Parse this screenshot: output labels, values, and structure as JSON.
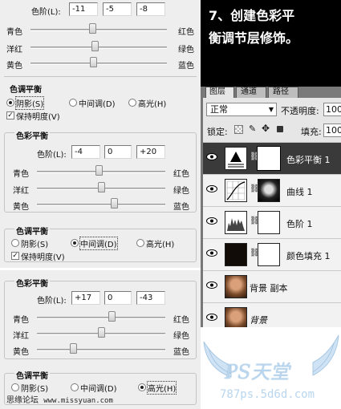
{
  "panel1": {
    "levels_label": "色阶(L):",
    "levels": [
      "-11",
      "-5",
      "-8"
    ],
    "rows": [
      {
        "left": "青色",
        "right": "红色",
        "pos": 0.45
      },
      {
        "left": "洋红",
        "right": "绿色",
        "pos": 0.47
      },
      {
        "left": "黄色",
        "right": "蓝色",
        "pos": 0.46
      }
    ]
  },
  "tone1": {
    "title": "色调平衡",
    "shadows": "阴影(S)",
    "midtones": "中间调(D)",
    "highlights": "高光(H)",
    "preserve": "保持明度(V)",
    "selected": "shadows",
    "preserve_checked": true
  },
  "panel2": {
    "title": "色彩平衡",
    "levels_label": "色阶(L):",
    "levels": [
      "-4",
      "0",
      "+20"
    ],
    "rows": [
      {
        "left": "青色",
        "right": "红色",
        "pos": 0.48
      },
      {
        "left": "洋红",
        "right": "绿色",
        "pos": 0.5
      },
      {
        "left": "黄色",
        "right": "蓝色",
        "pos": 0.6
      }
    ]
  },
  "tone2": {
    "title": "色调平衡",
    "shadows": "阴影(S)",
    "midtones": "中间调(D)",
    "highlights": "高光(H)",
    "preserve": "保持明度(V)",
    "selected": "midtones",
    "preserve_checked": true
  },
  "panel3": {
    "title": "色彩平衡",
    "levels_label": "色阶(L):",
    "levels": [
      "+17",
      "0",
      "-43"
    ],
    "rows": [
      {
        "left": "青色",
        "right": "红色",
        "pos": 0.58
      },
      {
        "left": "洋红",
        "right": "绿色",
        "pos": 0.5
      },
      {
        "left": "黄色",
        "right": "蓝色",
        "pos": 0.28
      }
    ]
  },
  "tone3": {
    "title": "色调平衡",
    "shadows": "阴影(S)",
    "midtones": "中间调(D)",
    "highlights": "高光(H)",
    "selected": "highlights"
  },
  "instruction": {
    "line1": "7、创建色彩平",
    "line2": "衡调节层修饰。"
  },
  "layers_panel": {
    "tabs": [
      "图层",
      "通道",
      "路径"
    ],
    "blend_mode": "正常",
    "opacity_label": "不透明度:",
    "opacity": "100",
    "lock_label": "锁定:",
    "fill_label": "填充:",
    "fill": "100",
    "layers": [
      {
        "name": "色彩平衡 1",
        "selected": true
      },
      {
        "name": "曲线 1",
        "selected": false
      },
      {
        "name": "色阶 1",
        "selected": false
      },
      {
        "name": "颜色填充 1",
        "selected": false
      },
      {
        "name": "背景 副本",
        "selected": false
      },
      {
        "name": "背景",
        "selected": false
      }
    ]
  },
  "watermark": {
    "forum": "思缘论坛",
    "forum_url": "www.missyuan.com",
    "brand": "PS天堂",
    "brand_url": "787ps.5d6d.com"
  },
  "colors": {
    "dialog_bg": "#eeeeee",
    "instruction_bg": "#000000",
    "selected_layer_bg": "#3a3a3a",
    "watermark_blue": "#b9d6ee"
  }
}
